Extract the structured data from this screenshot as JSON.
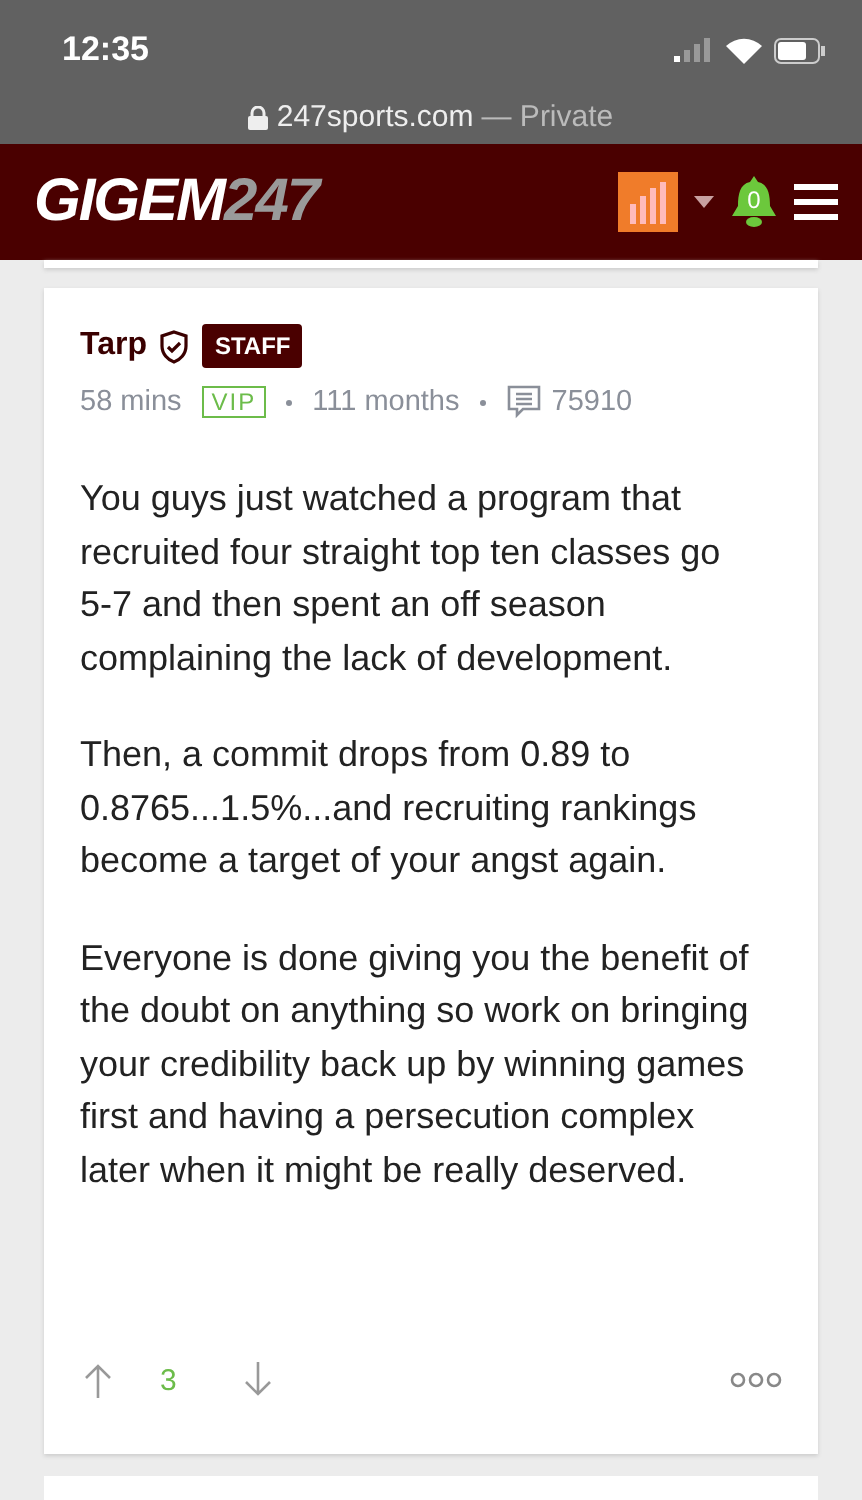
{
  "status_bar": {
    "time": "12:35"
  },
  "url_bar": {
    "domain": "247sports.com",
    "suffix": "— Private"
  },
  "header": {
    "logo": {
      "name": "GIGEM",
      "suffix": "247"
    },
    "notifications": "0"
  },
  "post": {
    "author": "Tarp",
    "badge": "STAFF",
    "time": "58 mins",
    "membership": "VIP",
    "tenure": "111 months",
    "posts": "75910",
    "paragraphs": [
      "You guys just watched a program that recruited four straight top ten classes go 5-7 and then spent an off season complaining the lack of development.",
      "Then, a commit drops from 0.89 to 0.8765...1.5%...and recruiting rankings become a target of your angst again.",
      "Everyone is done giving you the benefit of the doubt on anything so work on bringing your credibility back up by winning games first and having a persecution complex later when it might be really deserved."
    ],
    "votes": "3"
  }
}
